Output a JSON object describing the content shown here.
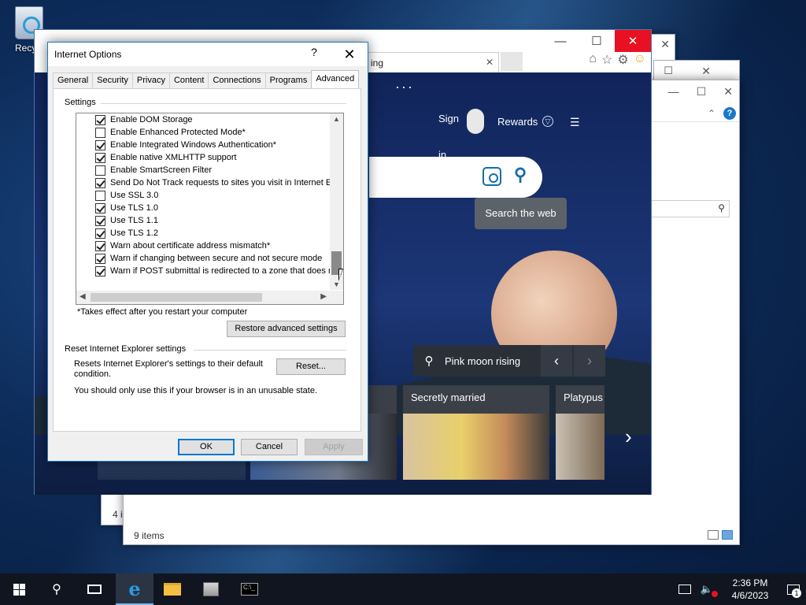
{
  "desktop": {
    "recycle_bin_label": "Recycl"
  },
  "explorer_back": {
    "status_partial": "4 i",
    "max_glyph": "☐",
    "close_glyph": "✕"
  },
  "explorer_mid": {
    "max_glyph": "☐",
    "close_glyph": "✕"
  },
  "explorer_front": {
    "status": "9 items",
    "min_glyph": "—",
    "max_glyph": "☐",
    "close_glyph": "✕",
    "help_glyph": "?",
    "collapse_glyph": "⌃",
    "search_glyph": "⚲"
  },
  "ie": {
    "tab_title_partial": "ing",
    "tab_close_glyph": "✕",
    "min_glyph": "—",
    "max_glyph": "☐",
    "close_glyph": "✕",
    "more_glyph": "···",
    "sign_in": "Sign in",
    "rewards": "Rewards",
    "search_tooltip": "Search the web",
    "image_caption": "Pink moon rising",
    "prev_glyph": "‹",
    "next_glyph": "›",
    "carousel_next_glyph": "›",
    "cards": [
      "Secretly married",
      "Platypus"
    ]
  },
  "dialog": {
    "title": "Internet Options",
    "help_glyph": "?",
    "close_glyph": "✕",
    "tabs": [
      "General",
      "Security",
      "Privacy",
      "Content",
      "Connections",
      "Programs",
      "Advanced"
    ],
    "active_tab": "Advanced",
    "settings_group_label": "Settings",
    "settings": [
      {
        "label": "Enable DOM Storage",
        "checked": true
      },
      {
        "label": "Enable Enhanced Protected Mode*",
        "checked": false
      },
      {
        "label": "Enable Integrated Windows Authentication*",
        "checked": true
      },
      {
        "label": "Enable native XMLHTTP support",
        "checked": true
      },
      {
        "label": "Enable SmartScreen Filter",
        "checked": false
      },
      {
        "label": "Send Do Not Track requests to sites you visit in Internet E",
        "checked": true
      },
      {
        "label": "Use SSL 3.0",
        "checked": false
      },
      {
        "label": "Use TLS 1.0",
        "checked": true
      },
      {
        "label": "Use TLS 1.1",
        "checked": true
      },
      {
        "label": "Use TLS 1.2",
        "checked": true
      },
      {
        "label": "Warn about certificate address mismatch*",
        "checked": true
      },
      {
        "label": "Warn if changing between secure and not secure mode",
        "checked": true
      },
      {
        "label": "Warn if POST submittal is redirected to a zone that does n",
        "checked": true
      }
    ],
    "scroll_up_glyph": "▲",
    "scroll_down_glyph": "▼",
    "scroll_left_glyph": "◀",
    "scroll_right_glyph": "▶",
    "restart_note": "*Takes effect after you restart your computer",
    "restore_button": "Restore advanced settings",
    "reset_group_label": "Reset Internet Explorer settings",
    "reset_description": "Resets Internet Explorer's settings to their default condition.",
    "reset_button": "Reset...",
    "reset_warning": "You should only use this if your browser is in an unusable state.",
    "ok_button": "OK",
    "cancel_button": "Cancel",
    "apply_button": "Apply"
  },
  "taskbar": {
    "search_glyph": "⚲",
    "ie_glyph": "e",
    "cmd_glyph": "C:\\_",
    "volume_glyph": "🔈",
    "time": "2:36 PM",
    "date": "4/6/2023",
    "notification_count": "1"
  }
}
